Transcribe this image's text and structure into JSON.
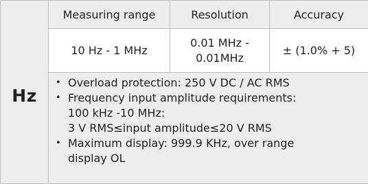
{
  "unit": "Hz",
  "headers": [
    "Measuring range",
    "Resolution",
    "Accuracy"
  ],
  "row": {
    "range": "10 Hz - 1 MHz",
    "resolution_line1": "0.01 MHz -",
    "resolution_line2": "0.01MHz",
    "accuracy": "± (1.0% + 5)"
  },
  "notes": [
    {
      "lines": [
        "Overload protection: 250 V DC / AC RMS"
      ]
    },
    {
      "lines": [
        "Frequency input amplitude requirements:",
        "100 kHz -10 MHz:",
        "3 V RMS≤input amplitude≤20 V RMS"
      ]
    },
    {
      "lines": [
        "Maximum display: 999.9 KHz, over range",
        "display OL"
      ]
    }
  ]
}
